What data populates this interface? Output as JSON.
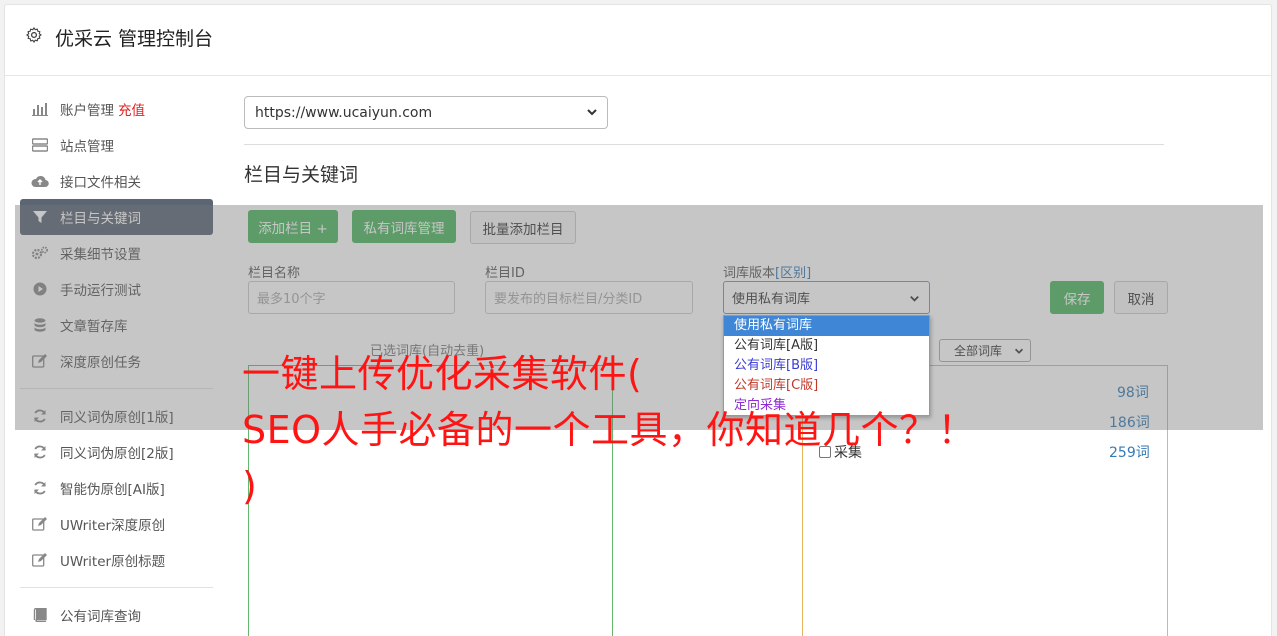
{
  "header": {
    "title": "优采云 管理控制台"
  },
  "sidebar": {
    "items": [
      {
        "label": "账户管理",
        "extra": "充值",
        "icon": "bar-chart-icon"
      },
      {
        "label": "站点管理",
        "icon": "server-icon"
      },
      {
        "label": "接口文件相关",
        "icon": "cloud-upload-icon"
      },
      {
        "label": "栏目与关键词",
        "icon": "filter-icon",
        "active": true
      },
      {
        "label": "采集细节设置",
        "icon": "cogs-icon"
      },
      {
        "label": "手动运行测试",
        "icon": "play-circle-icon"
      },
      {
        "label": "文章暂存库",
        "icon": "database-icon"
      },
      {
        "label": "深度原创任务",
        "icon": "edit-icon"
      },
      {
        "label": "同义词伪原创[1版]",
        "icon": "refresh-icon"
      },
      {
        "label": "同义词伪原创[2版]",
        "icon": "refresh-icon"
      },
      {
        "label": "智能伪原创[AI版]",
        "icon": "refresh-icon"
      },
      {
        "label": "UWriter深度原创",
        "icon": "edit-icon"
      },
      {
        "label": "UWriter原创标题",
        "icon": "edit-icon"
      },
      {
        "label": "公有词库查询",
        "icon": "book-icon"
      }
    ]
  },
  "main": {
    "site_select_value": "https://www.ucaiyun.com",
    "section_title": "栏目与关键词",
    "buttons": {
      "add_column": "添加栏目 +",
      "private_lib": "私有词库管理",
      "batch_add": "批量添加栏目",
      "save": "保存",
      "cancel": "取消"
    },
    "form": {
      "column_name_label": "栏目名称",
      "column_name_placeholder": "最多10个字",
      "column_id_label": "栏目ID",
      "column_id_placeholder": "要发布的目标栏目/分类ID",
      "lib_version_label": "词库版本",
      "lib_version_link": "[区别]",
      "lib_version_value": "使用私有词库"
    },
    "dropdown_options": [
      {
        "label": "使用私有词库",
        "color": "#ffffff",
        "selected": true
      },
      {
        "label": "公有词库[A版]",
        "color": "#333333"
      },
      {
        "label": "公有词库[B版]",
        "color": "#3b3bd6"
      },
      {
        "label": "公有词库[C版]",
        "color": "#c0392b"
      },
      {
        "label": "定向采集",
        "color": "#8e2bd6"
      }
    ],
    "selected_lib_label": "已选词库(自动去重)",
    "all_libs_select": "全部词库",
    "keyword_counts": [
      "98词",
      "186词",
      "259词"
    ],
    "keyword_last_label": "采集"
  },
  "overlay_text": {
    "line1": "一键上传优化采集软件(",
    "line2": "SEO人手必备的一个工具，你知道几个？！",
    "line3": ")"
  }
}
